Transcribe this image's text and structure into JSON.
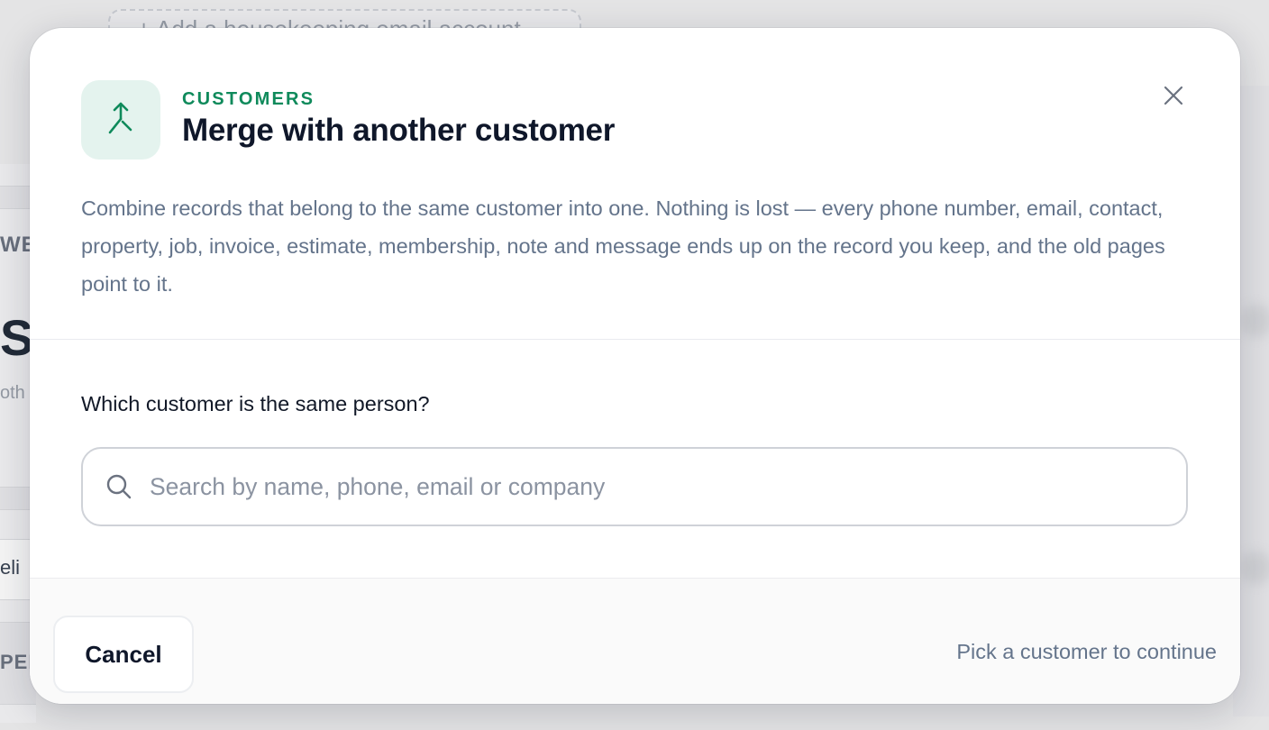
{
  "background": {
    "pill_text": "+ Add a housekeeping email account",
    "fragments": {
      "we": "WE",
      "sc": "SC",
      "oth": "oth",
      "eli": "eli",
      "pen": "PEN"
    }
  },
  "modal": {
    "header": {
      "icon": "merge-icon",
      "eyebrow": "CUSTOMERS",
      "title": "Merge with another customer",
      "close_icon": "close-icon"
    },
    "description": "Combine records that belong to the same customer into one. Nothing is lost — every phone number, email, contact, property, job, invoice, estimate, membership, note and message ends up on the record you keep, and the old pages point to it.",
    "search": {
      "label": "Which customer is the same person?",
      "icon": "search-icon",
      "value": "",
      "placeholder": "Search by name, phone, email or company"
    },
    "footer": {
      "cancel_label": "Cancel",
      "hint": "Pick a customer to continue"
    }
  },
  "colors": {
    "accent": "#0f8a5b",
    "accent_tile": "#e4f3ee",
    "title": "#0f172a",
    "muted": "#64748b",
    "border": "#cfd2d8"
  }
}
